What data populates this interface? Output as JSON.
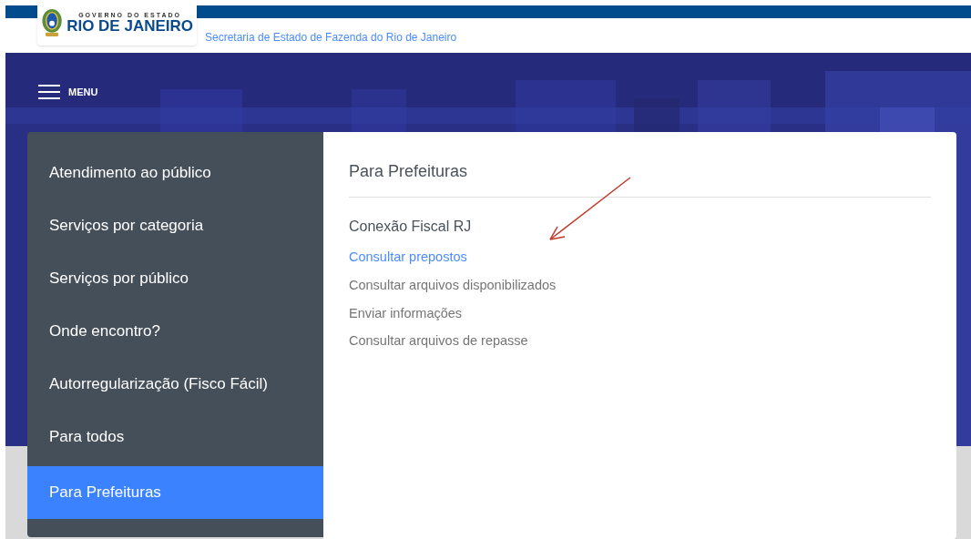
{
  "logo": {
    "line_1": "GOVERNO DO ESTADO",
    "line_2": "RIO DE JANEIRO"
  },
  "header": {
    "subtitle": "Secretaria de Estado de Fazenda do Rio de Janeiro"
  },
  "menu_button": {
    "label": "MENU"
  },
  "menu": {
    "items": [
      {
        "label": "Atendimento ao público",
        "selected": false
      },
      {
        "label": "Serviços por categoria",
        "selected": false
      },
      {
        "label": "Serviços por público",
        "selected": false
      },
      {
        "label": "Onde encontro?",
        "selected": false
      },
      {
        "label": "Autorregularização (Fisco Fácil)",
        "selected": false
      },
      {
        "label": "Para todos",
        "selected": false
      },
      {
        "label": "Para Prefeituras",
        "selected": true
      }
    ]
  },
  "panel": {
    "title": "Para Prefeituras",
    "entries": [
      {
        "kind": "heading",
        "label": "Conexão Fiscal RJ"
      },
      {
        "kind": "link",
        "label": "Consultar prepostos",
        "highlighted": true
      },
      {
        "kind": "link",
        "label": "Consultar arquivos disponibilizados",
        "highlighted": false
      },
      {
        "kind": "link",
        "label": "Enviar informações",
        "highlighted": false
      },
      {
        "kind": "link",
        "label": "Consultar arquivos de repasse",
        "highlighted": false
      }
    ]
  }
}
